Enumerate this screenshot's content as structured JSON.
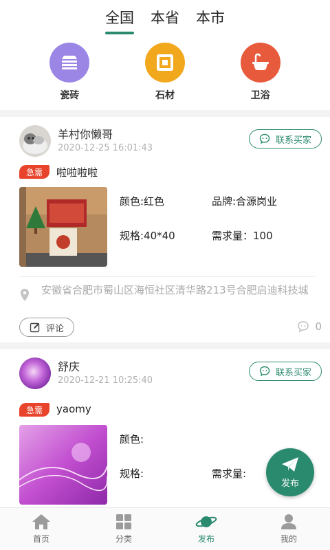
{
  "scope_tabs": [
    {
      "label": "全国",
      "active": true
    },
    {
      "label": "本省",
      "active": false
    },
    {
      "label": "本市",
      "active": false
    }
  ],
  "categories": [
    {
      "label": "瓷砖",
      "icon": "tile-stack-icon",
      "color": "#9b86e6"
    },
    {
      "label": "石材",
      "icon": "stone-square-icon",
      "color": "#f2a81d"
    },
    {
      "label": "卫浴",
      "icon": "bathtub-icon",
      "color": "#e85a3c"
    }
  ],
  "posts": [
    {
      "user": "羊村你懒哥",
      "time": "2020-12-25 16:01:43",
      "contact_label": "联系买家",
      "badge": "急需",
      "title": "啦啦啦啦",
      "color_label": "颜色:红色",
      "brand_label": "品牌:合源岗业",
      "spec_label": "规格:40*40",
      "demand_label": "需求量：100",
      "location": "安徽省合肥市蜀山区海恒社区清华路213号合肥启迪科技城",
      "comment_label": "评论",
      "comment_count": "0"
    },
    {
      "user": "舒庆",
      "time": "2020-12-21 10:25:40",
      "contact_label": "联系买家",
      "badge": "急需",
      "title": "yaomy",
      "color_label": "颜色:",
      "spec_label": "规格:",
      "demand_label": "需求量:"
    }
  ],
  "fab": {
    "label": "发布"
  },
  "bottom_nav": [
    {
      "label": "首页",
      "icon": "home-icon",
      "active": false
    },
    {
      "label": "分类",
      "icon": "grid-icon",
      "active": false
    },
    {
      "label": "发布",
      "icon": "planet-icon",
      "active": true
    },
    {
      "label": "我的",
      "icon": "user-icon",
      "active": false
    }
  ],
  "colors": {
    "accent": "#2a8a6e",
    "urgent": "#e8442b"
  }
}
